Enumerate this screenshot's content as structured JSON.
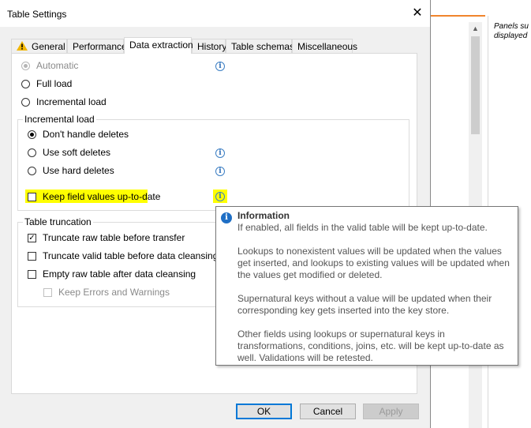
{
  "dialog": {
    "title": "Table Settings",
    "close_glyph": "✕",
    "tabs": [
      {
        "label": "General",
        "icon": "warning-icon"
      },
      {
        "label": "Performance"
      },
      {
        "label": "Data extraction",
        "active": true
      },
      {
        "label": "History"
      },
      {
        "label": "Table schemas"
      },
      {
        "label": "Miscellaneous"
      }
    ]
  },
  "load_mode": {
    "automatic": "Automatic",
    "full_load": "Full load",
    "incremental_load": "Incremental load",
    "selected": "automatic"
  },
  "incremental_group": {
    "legend": "Incremental load",
    "dont_handle_deletes": "Don't handle deletes",
    "use_soft_deletes": "Use soft deletes",
    "use_hard_deletes": "Use hard deletes",
    "keep_field_values": "Keep field values up-to-date",
    "selected": "dont_handle_deletes"
  },
  "truncation_group": {
    "legend": "Table truncation",
    "truncate_raw": "Truncate raw table before transfer",
    "truncate_raw_checked": true,
    "truncate_valid": "Truncate valid table before data cleansing",
    "empty_raw": "Empty raw table after data cleansing",
    "keep_errors": "Keep Errors and Warnings"
  },
  "info_glyph": "i",
  "check_glyph": "✓",
  "buttons": {
    "ok": "OK",
    "cancel": "Cancel",
    "apply": "Apply"
  },
  "tooltip": {
    "title": "Information",
    "paragraphs": [
      "If enabled, all fields in the valid table will be kept up-to-date.",
      "Lookups to nonexistent values will be updated when the values get inserted, and lookups to existing values will be updated when the values get modified or deleted.",
      "Supernatural keys without a value will be updated when their corresponding key gets inserted into the key store.",
      "Other fields using lookups or supernatural keys in transformations, conditions, joins, etc. will be kept up-to-date as well. Validations will be retested."
    ]
  },
  "background": {
    "panel_note": "Panels su\ndisplayed",
    "scroll_up_glyph": "▲"
  },
  "colors": {
    "highlight": "#ffff00",
    "accent_orange": "#f0842c",
    "primary_border": "#0078d7",
    "info_blue": "#1f6fc5"
  }
}
